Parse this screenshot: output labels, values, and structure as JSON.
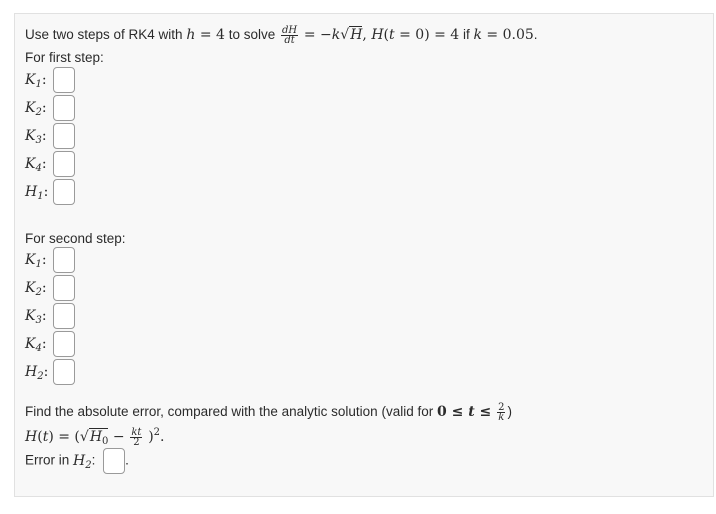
{
  "question": {
    "intro": "Use two steps of RK4 with",
    "to_solve": "to solve",
    "if_text": "if",
    "h_eq": "h = 4",
    "ode_rhs": "= −k√H, H(t = 0) = 4",
    "k_eq": "k = 0.05."
  },
  "step1": {
    "heading": "For first step:",
    "rows": [
      {
        "sym": "K",
        "sub": "1"
      },
      {
        "sym": "K",
        "sub": "2"
      },
      {
        "sym": "K",
        "sub": "3"
      },
      {
        "sym": "K",
        "sub": "4"
      },
      {
        "sym": "H",
        "sub": "1"
      }
    ]
  },
  "step2": {
    "heading": "For second step:",
    "rows": [
      {
        "sym": "K",
        "sub": "1"
      },
      {
        "sym": "K",
        "sub": "2"
      },
      {
        "sym": "K",
        "sub": "3"
      },
      {
        "sym": "K",
        "sub": "4"
      },
      {
        "sym": "H",
        "sub": "2"
      }
    ]
  },
  "error": {
    "text": "Find the absolute error, compared with the analytic solution (valid for",
    "range": "0 ≤ t ≤",
    "analytic": "H(t) = (√H₀ − kt/2)².",
    "label": "Error in"
  }
}
